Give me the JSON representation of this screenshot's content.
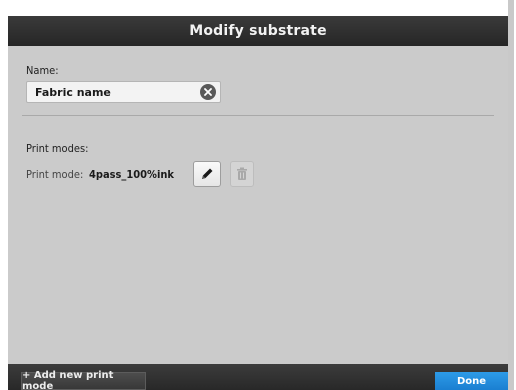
{
  "dialog": {
    "title": "Modify substrate"
  },
  "name_section": {
    "label": "Name:",
    "value": "Fabric name",
    "clear_icon": "close-circle-icon"
  },
  "print_modes": {
    "section_label": "Print modes:",
    "row_label": "Print mode:",
    "row_value": "4pass_100%ink",
    "edit_icon": "pencil-icon",
    "delete_icon": "trash-icon"
  },
  "footer": {
    "add_label": "+ Add new print mode",
    "done_label": "Done"
  },
  "colors": {
    "title_bar": "#2e2e2e",
    "content_bg": "#cbcbcb",
    "accent_done": "#1a8ae0"
  }
}
